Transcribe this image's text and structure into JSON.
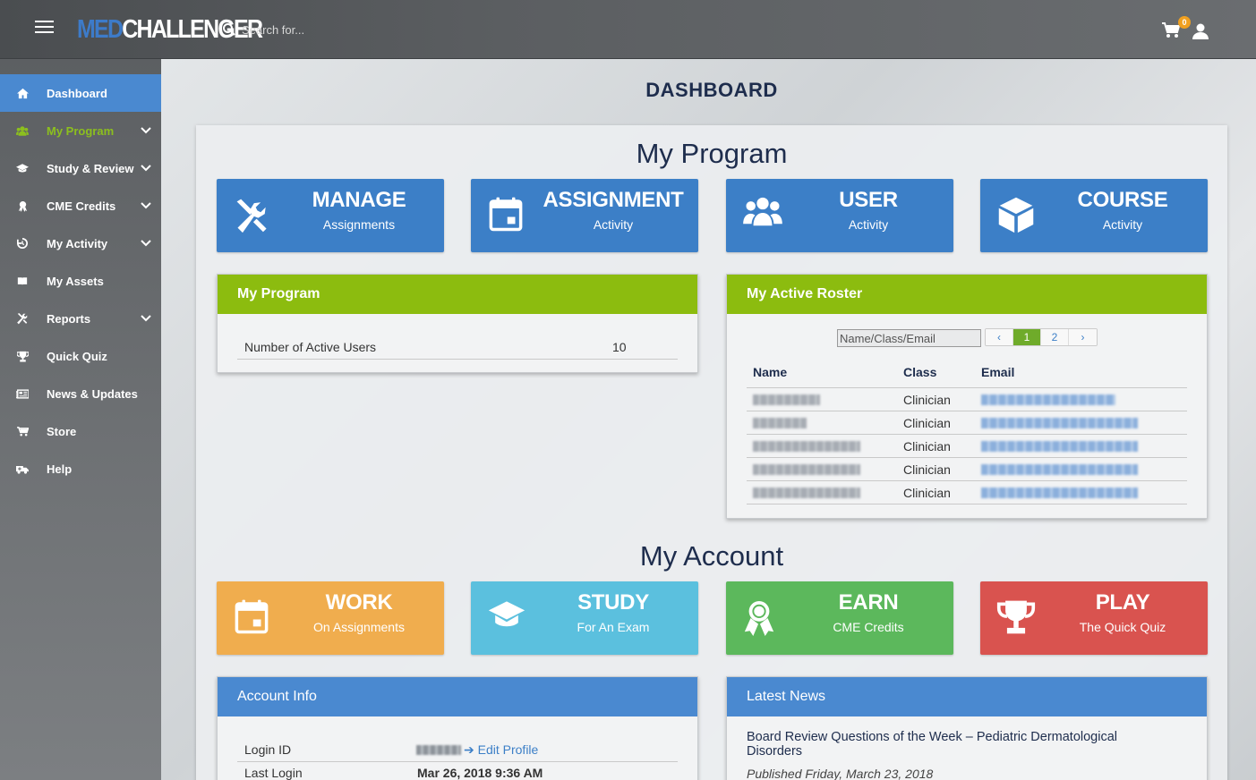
{
  "header": {
    "logo_med": "MED",
    "logo_challenger": "CHALLENGER",
    "search_placeholder": "Search for...",
    "cart_count": "0"
  },
  "sidebar": {
    "items": [
      {
        "label": "Dashboard",
        "icon": "home-icon",
        "active": true,
        "chevron": false
      },
      {
        "label": "My Program",
        "icon": "users-icon",
        "highlight": "green",
        "chevron": true
      },
      {
        "label": "Study & Review",
        "icon": "graduation-cap-icon",
        "chevron": true
      },
      {
        "label": "CME Credits",
        "icon": "award-icon",
        "chevron": true
      },
      {
        "label": "My Activity",
        "icon": "history-icon",
        "chevron": true
      },
      {
        "label": "My Assets",
        "icon": "book-icon",
        "chevron": false
      },
      {
        "label": "Reports",
        "icon": "tools-icon",
        "chevron": true
      },
      {
        "label": "Quick Quiz",
        "icon": "trophy-icon",
        "chevron": false
      },
      {
        "label": "News & Updates",
        "icon": "newspaper-icon",
        "chevron": false
      },
      {
        "label": "Store",
        "icon": "cart-icon",
        "chevron": false
      },
      {
        "label": "Help",
        "icon": "ambulance-icon",
        "chevron": false
      }
    ]
  },
  "main": {
    "page_title": "DASHBOARD",
    "program_section_title": "My Program",
    "account_section_title": "My Account",
    "program_tiles": [
      {
        "title": "MANAGE",
        "subtitle": "Assignments",
        "icon": "tools-icon",
        "color": "#3c7fc7"
      },
      {
        "title": "ASSIGNMENT",
        "subtitle": "Activity",
        "icon": "calendar-icon",
        "color": "#3c7fc7"
      },
      {
        "title": "USER",
        "subtitle": "Activity",
        "icon": "users-icon",
        "color": "#3c7fc7"
      },
      {
        "title": "COURSE",
        "subtitle": "Activity",
        "icon": "cube-icon",
        "color": "#3c7fc7"
      }
    ],
    "account_tiles": [
      {
        "title": "WORK",
        "subtitle": "On Assignments",
        "icon": "calendar-icon",
        "color": "#f0ad4e"
      },
      {
        "title": "STUDY",
        "subtitle": "For An Exam",
        "icon": "graduation-cap-icon",
        "color": "#5bc0de"
      },
      {
        "title": "EARN",
        "subtitle": "CME Credits",
        "icon": "award-icon",
        "color": "#5cb85c"
      },
      {
        "title": "PLAY",
        "subtitle": "The Quick Quiz",
        "icon": "trophy-icon",
        "color": "#d9534f"
      }
    ],
    "my_program_card": {
      "title": "My Program",
      "label": "Number of Active Users",
      "value": "10"
    },
    "roster_card": {
      "title": "My Active Roster",
      "search_placeholder": "Name/Class/Email",
      "pager": [
        "‹",
        "1",
        "2",
        "›"
      ],
      "current_page": "1",
      "columns": [
        "Name",
        "Class",
        "Email"
      ],
      "rows": [
        {
          "class": "Clinician"
        },
        {
          "class": "Clinician"
        },
        {
          "class": "Clinician"
        },
        {
          "class": "Clinician"
        },
        {
          "class": "Clinician"
        }
      ]
    },
    "account_info_card": {
      "title": "Account Info",
      "login_id_label": "Login ID",
      "edit_profile": "Edit Profile",
      "last_login_label": "Last Login",
      "last_login_value": "Mar 26, 2018 9:36 AM"
    },
    "latest_news_card": {
      "title": "Latest News",
      "headline": "Board Review Questions of the Week – Pediatric Dermatological Disorders",
      "published": "Published Friday, March 23, 2018"
    }
  },
  "colors": {
    "accent_blue": "#4a89d0",
    "tile_blue": "#3c7fc7",
    "card_green": "#8cbc0f",
    "sidebar_active": "#4a89d0",
    "title_navy": "#1e2d4d"
  }
}
